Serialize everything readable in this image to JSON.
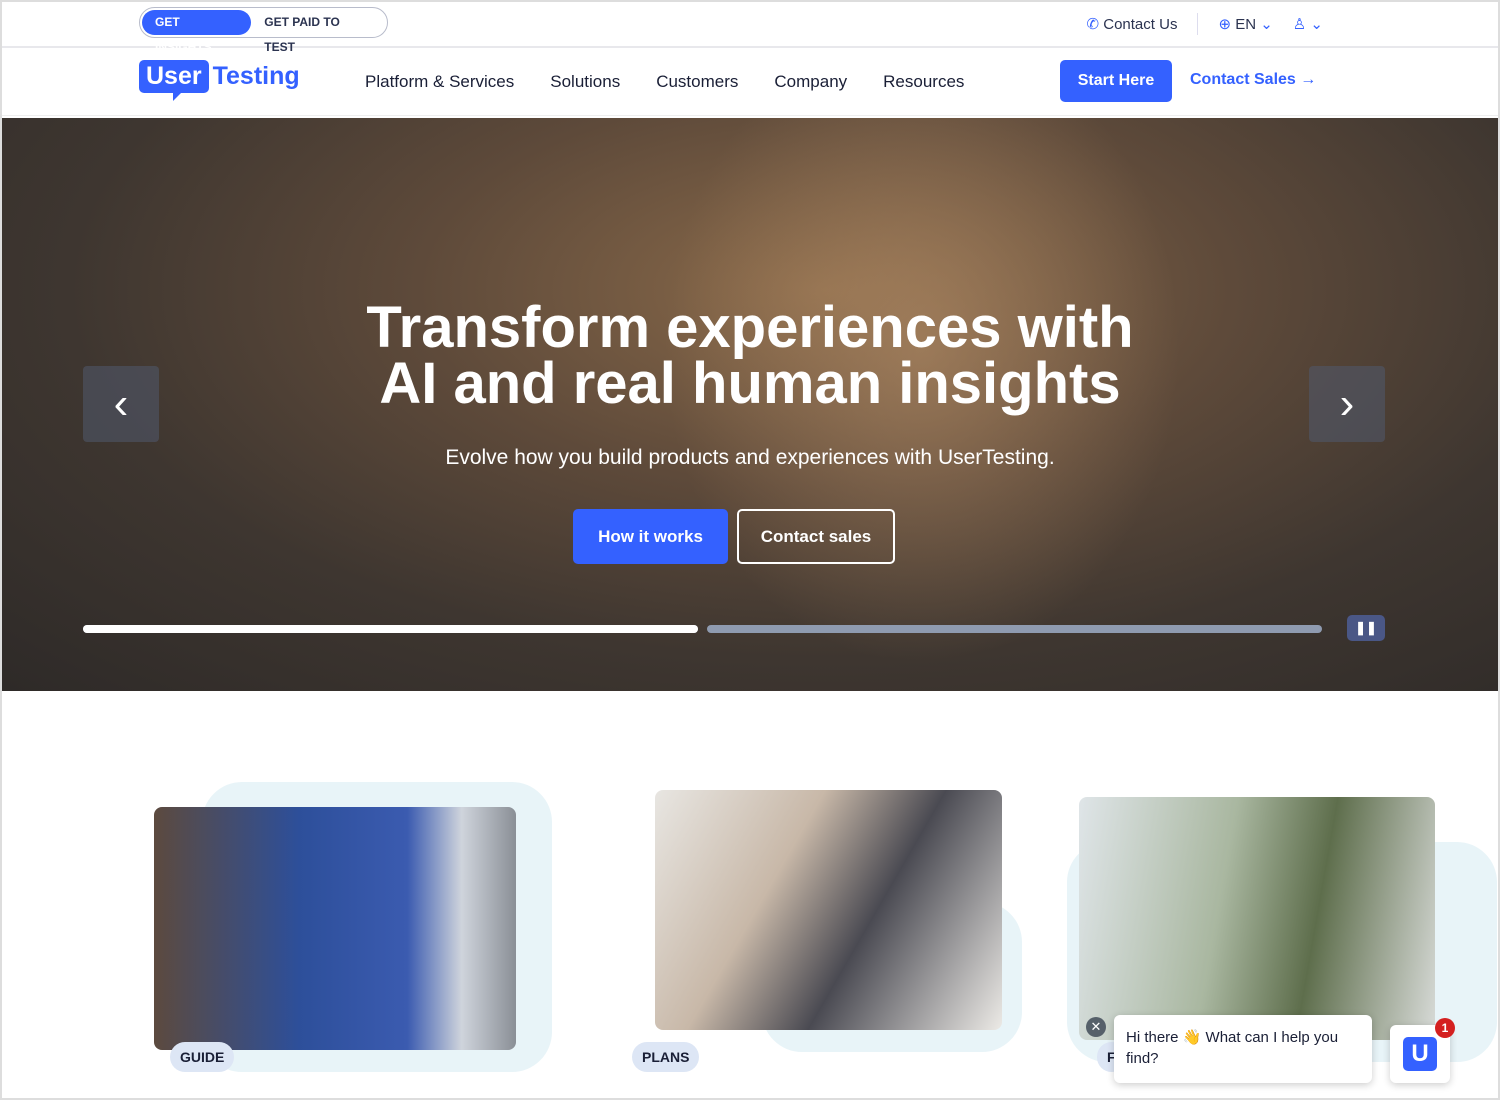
{
  "topbar": {
    "toggle": [
      "GET INSIGHTS",
      "GET PAID TO TEST"
    ],
    "contact_us": "Contact Us",
    "language": "EN"
  },
  "nav": {
    "logo_user": "User",
    "logo_testing": "Testing",
    "menu": [
      "Platform & Services",
      "Solutions",
      "Customers",
      "Company",
      "Resources"
    ],
    "start_here": "Start Here",
    "contact_sales": "Contact Sales"
  },
  "hero": {
    "title_line1": "Transform experiences with",
    "title_line2": "AI and real human insights",
    "subtitle": "Evolve how you build products and experiences with UserTesting.",
    "primary_button": "How it works",
    "secondary_button": "Contact sales",
    "slide_progress": [
      100,
      0
    ],
    "prev_icon": "chevron-left",
    "next_icon": "chevron-right",
    "pause_icon": "pause"
  },
  "cards": [
    {
      "tag": "GUIDE"
    },
    {
      "tag": "PLANS"
    },
    {
      "tag": "F"
    }
  ],
  "chat": {
    "message": "Hi there 👋 What can I help you find?",
    "unread": "1",
    "logo": "U"
  },
  "colors": {
    "accent": "#3461ff"
  }
}
